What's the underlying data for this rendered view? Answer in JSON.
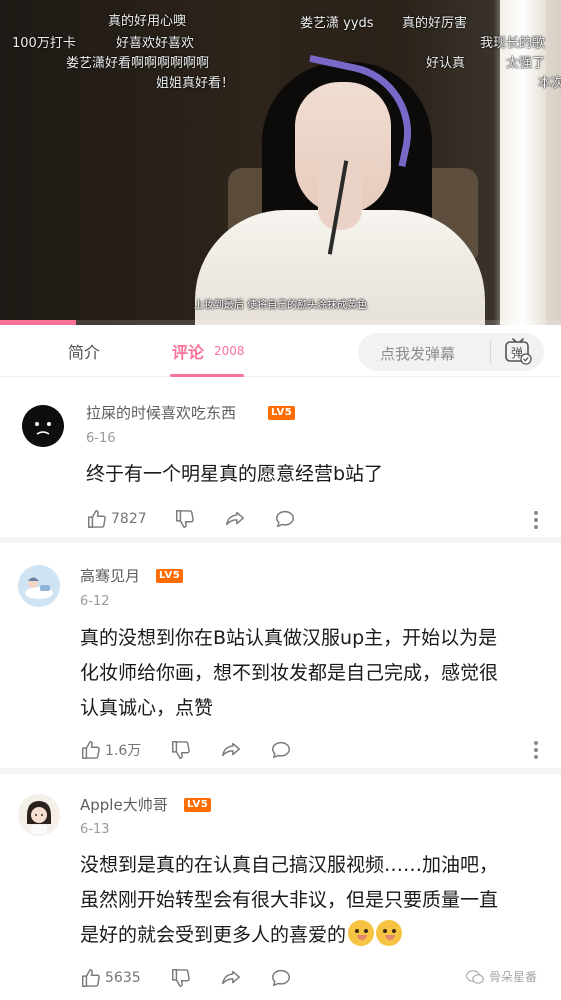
{
  "video": {
    "subtitle": "上妆到最后 便将自己的额头涂抹成黄色",
    "progress_fraction": 0.135,
    "danmaku": [
      "真的好用心噢",
      "娄艺潇 yyds",
      "真的好厉害",
      "100万打卡",
      "好喜欢好喜欢",
      "我现长的歌",
      "娄艺潇好看啊啊啊啊啊啊",
      "好认真",
      "太强了",
      "姐姐真好看！",
      "本次"
    ]
  },
  "tabs": {
    "intro_label": "简介",
    "comments_label": "评论",
    "comments_count": "2008",
    "danmu_placeholder": "点我发弹幕"
  },
  "comments": [
    {
      "username": "拉屎的时候喜欢吃东西",
      "level": "LV5",
      "date": "6-16",
      "lines": [
        "终于有一个明星真的愿意经营b站了"
      ],
      "likes": "7827"
    },
    {
      "username": "高骞见月",
      "level": "LV5",
      "date": "6-12",
      "lines": [
        "真的没想到你在B站认真做汉服up主，开始以为是",
        "化妆师给你画，想不到妆发都是自己完成，感觉很",
        "认真诚心，点赞"
      ],
      "likes": "1.6万"
    },
    {
      "username": "Apple大帅哥",
      "level": "LV5",
      "date": "6-13",
      "lines": [
        "没想到是真的在认真自己搞汉服视频……加油吧，",
        "虽然刚开始转型会有很大非议，但是只要质量一直",
        "是好的就会受到更多人的喜爱的"
      ],
      "likes": "5635"
    }
  ],
  "icons": {
    "like": "thumbs-up-icon",
    "dislike": "thumbs-down-icon",
    "share": "share-icon",
    "reply": "comment-icon",
    "more": "more-vertical-icon",
    "danmu_toggle": "danmaku-toggle-icon",
    "emoji": "thinking-emoji-icon"
  },
  "watermark": {
    "text": "骨朵星番"
  },
  "colors": {
    "accent": "#fb7299",
    "level_badge": "#ff6c00"
  }
}
